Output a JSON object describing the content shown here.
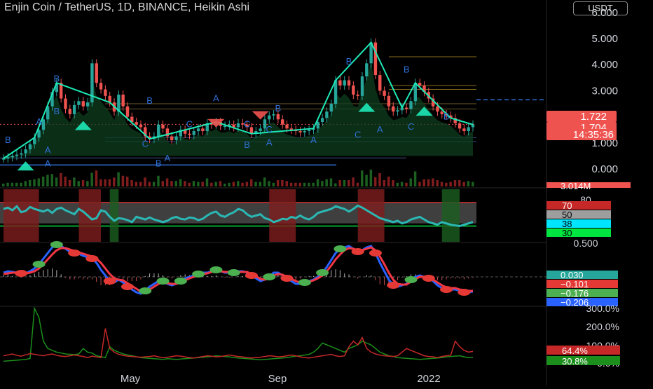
{
  "header": {
    "title": "Enjin Coin / TetherUS, 1D, BINANCE, Heikin Ashi",
    "currency_button": "USDT"
  },
  "colors": {
    "background": "#000000",
    "up": "#26a69a",
    "down": "#ef5350",
    "zigzag": "#1de9b6",
    "rsi_line": "#2bb7b3",
    "macd_fast": "#2962ff",
    "macd_slow": "#f23645",
    "dot_green": "#4caf50",
    "dot_red": "#e53935",
    "label_blue": "#2f6fd6"
  },
  "x_axis": {
    "labels": [
      "May",
      "Sep",
      "2022"
    ]
  },
  "chart_data": [
    {
      "type": "candlestick",
      "pane": "price",
      "ylim": [
        0,
        6
      ],
      "y_ticks": [
        "6.000",
        "5.000",
        "4.000",
        "3.000",
        "1.000",
        "0.000"
      ],
      "series": [
        {
          "name": "ENJUSDT",
          "values": [
            0.4,
            0.45,
            0.5,
            0.55,
            0.6,
            0.75,
            0.95,
            1.2,
            1.5,
            1.9,
            2.4,
            2.95,
            3.3,
            2.7,
            2.3,
            2.1,
            2.45,
            2.6,
            2.4,
            2.55,
            4.05,
            3.3,
            3.05,
            2.8,
            2.55,
            2.2,
            2.85,
            2.4,
            2.0,
            1.8,
            1.7,
            1.6,
            1.25,
            1.15,
            1.25,
            1.7,
            1.55,
            1.25,
            1.1,
            1.25,
            1.5,
            1.35,
            1.3,
            1.45,
            1.55,
            1.45,
            1.75,
            1.7,
            1.8,
            1.65,
            1.65,
            1.7,
            1.6,
            1.75,
            1.7,
            1.6,
            1.35,
            1.45,
            1.55,
            1.9,
            2.05,
            2.1,
            1.9,
            1.7,
            1.55,
            1.5,
            1.45,
            1.4,
            1.45,
            1.5,
            1.55,
            1.8,
            1.95,
            2.2,
            2.5,
            3.4,
            3.2,
            3.4,
            3.2,
            2.85,
            2.8,
            3.55,
            4.05,
            4.85,
            3.6,
            3.0,
            2.8,
            2.4,
            2.2,
            2.25,
            2.35,
            2.3,
            2.6,
            3.3,
            3.2,
            2.95,
            2.7,
            2.4,
            2.2,
            2.1,
            2.05,
            1.95,
            1.75,
            1.55,
            1.45,
            1.6,
            1.7
          ]
        }
      ],
      "price_labels": [
        {
          "text": "1.722",
          "color": "#ef5350"
        },
        {
          "text": "1.704",
          "color": "#ef5350"
        },
        {
          "text": "14:35:36",
          "color": "#ef5350"
        }
      ],
      "volume_label": {
        "text": "3.014M",
        "color": "#ef5350"
      },
      "pattern_labels": [
        "B",
        "B",
        "A",
        "B",
        "C",
        "A",
        "B",
        "A",
        "C",
        "B",
        "A",
        "B",
        "C",
        "A",
        "B",
        "C",
        "A",
        "B",
        "C",
        "A",
        "B",
        "C",
        "A",
        "B"
      ]
    },
    {
      "type": "line",
      "pane": "rsi",
      "ylim": [
        10,
        90
      ],
      "y_ticks": [
        "80"
      ],
      "levels": [
        {
          "text": "70",
          "color": "#c62828",
          "text_color": "#ffffff"
        },
        {
          "text": "50",
          "color": "#9e9e9e",
          "text_color": "#000000"
        },
        {
          "text": "38",
          "color": "#00e5ff",
          "text_color": "#000000"
        },
        {
          "text": "30",
          "color": "#00e640",
          "text_color": "#000000"
        }
      ],
      "series": [
        {
          "name": "RSI",
          "values": [
            60,
            62,
            58,
            64,
            55,
            57,
            63,
            60,
            58,
            56,
            59,
            54,
            60,
            62,
            58,
            55,
            52,
            60,
            56,
            50,
            44,
            46,
            58,
            56,
            48,
            42,
            46,
            45,
            43,
            40,
            48,
            46,
            44,
            47,
            44,
            42,
            40,
            42,
            46,
            48,
            45,
            44,
            47,
            46,
            43,
            45,
            50,
            54,
            56,
            50,
            48,
            52,
            55,
            60,
            58,
            52,
            48,
            50,
            52,
            46,
            44,
            40,
            42,
            45,
            44,
            48,
            46,
            50,
            46,
            44,
            48,
            54,
            56,
            58,
            60,
            64,
            62,
            60,
            56,
            60,
            65,
            62,
            58,
            54,
            50,
            46,
            44,
            42,
            40,
            42,
            38,
            40,
            44,
            46,
            48,
            44,
            40,
            38,
            36,
            40,
            38,
            36,
            35,
            34,
            36,
            38,
            40
          ]
        }
      ]
    },
    {
      "type": "line",
      "pane": "macd",
      "y_ticks": [
        "0.500"
      ],
      "value_labels": [
        {
          "text": "0.030",
          "color": "#26a69a"
        },
        {
          "text": "−0.101",
          "color": "#e53935"
        },
        {
          "text": "−0.176",
          "color": "#4caf50"
        },
        {
          "text": "−0.206",
          "color": "#2962ff"
        }
      ],
      "series": [
        {
          "name": "fast",
          "values": [
            0.06,
            0.08,
            0.07,
            0.06,
            0.05,
            0.05,
            0.08,
            0.12,
            0.18,
            0.26,
            0.34,
            0.42,
            0.46,
            0.44,
            0.4,
            0.36,
            0.34,
            0.33,
            0.3,
            0.28,
            0.26,
            0.2,
            0.1,
            0.02,
            -0.06,
            -0.08,
            -0.04,
            -0.08,
            -0.14,
            -0.18,
            -0.22,
            -0.24,
            -0.2,
            -0.14,
            -0.1,
            -0.06,
            -0.06,
            -0.1,
            -0.12,
            -0.1,
            -0.06,
            -0.02,
            0.0,
            0.02,
            0.04,
            0.06,
            0.06,
            0.08,
            0.1,
            0.08,
            0.06,
            0.06,
            0.06,
            0.08,
            0.08,
            0.06,
            0.02,
            -0.02,
            -0.06,
            -0.04,
            0.0,
            0.06,
            0.06,
            0.02,
            -0.02,
            -0.06,
            -0.1,
            -0.1,
            -0.08,
            -0.06,
            -0.04,
            0.0,
            0.06,
            0.14,
            0.24,
            0.34,
            0.4,
            0.42,
            0.44,
            0.4,
            0.36,
            0.38,
            0.42,
            0.44,
            0.34,
            0.2,
            0.08,
            -0.04,
            -0.12,
            -0.14,
            -0.12,
            -0.1,
            -0.04,
            0.0,
            0.02,
            0.0,
            -0.02,
            -0.06,
            -0.12,
            -0.16,
            -0.18,
            -0.18,
            -0.18,
            -0.2,
            -0.22,
            -0.22,
            -0.21
          ]
        },
        {
          "name": "slow",
          "values": [
            0.04,
            0.05,
            0.06,
            0.06,
            0.06,
            0.05,
            0.06,
            0.08,
            0.12,
            0.18,
            0.25,
            0.32,
            0.38,
            0.41,
            0.41,
            0.39,
            0.37,
            0.35,
            0.33,
            0.31,
            0.29,
            0.26,
            0.2,
            0.12,
            0.04,
            -0.02,
            -0.04,
            -0.05,
            -0.09,
            -0.13,
            -0.17,
            -0.21,
            -0.21,
            -0.18,
            -0.14,
            -0.1,
            -0.08,
            -0.09,
            -0.1,
            -0.1,
            -0.08,
            -0.05,
            -0.02,
            0.0,
            0.02,
            0.04,
            0.05,
            0.07,
            0.08,
            0.08,
            0.07,
            0.07,
            0.06,
            0.07,
            0.07,
            0.07,
            0.04,
            0.01,
            -0.03,
            -0.04,
            -0.02,
            0.02,
            0.04,
            0.03,
            0.0,
            -0.03,
            -0.06,
            -0.08,
            -0.08,
            -0.07,
            -0.05,
            -0.02,
            0.02,
            0.08,
            0.16,
            0.25,
            0.32,
            0.38,
            0.41,
            0.4,
            0.38,
            0.38,
            0.4,
            0.42,
            0.38,
            0.29,
            0.18,
            0.06,
            -0.04,
            -0.1,
            -0.11,
            -0.11,
            -0.07,
            -0.03,
            0.0,
            0.0,
            -0.01,
            -0.04,
            -0.08,
            -0.12,
            -0.15,
            -0.16,
            -0.16,
            -0.18,
            -0.19,
            -0.2,
            -0.2
          ]
        }
      ]
    },
    {
      "type": "line",
      "pane": "volatility",
      "y_ticks": [
        "300.0%",
        "200.0%",
        "100.0%",
        "0.0%"
      ],
      "value_labels": [
        {
          "text": "64.4%",
          "color": "#c62828"
        },
        {
          "text": "30.8%",
          "color": "#1b8e1b"
        }
      ],
      "series": [
        {
          "name": "red",
          "values": [
            40,
            45,
            50,
            42,
            38,
            45,
            52,
            48,
            44,
            40,
            46,
            50,
            42,
            38,
            36,
            40,
            44,
            40,
            36,
            30,
            38,
            34,
            30,
            190,
            80,
            60,
            48,
            42,
            38,
            36,
            34,
            32,
            34,
            36,
            40,
            34,
            30,
            32,
            36,
            40,
            38,
            34,
            30,
            28,
            32,
            36,
            40,
            38,
            34,
            36,
            40,
            44,
            40,
            36,
            34,
            30,
            28,
            30,
            32,
            36,
            40,
            38,
            34,
            36,
            40,
            44,
            40,
            34,
            30,
            28,
            32,
            36,
            40,
            44,
            48,
            40,
            36,
            40,
            90,
            120,
            100,
            140,
            80,
            60,
            50,
            44,
            40,
            38,
            36,
            40,
            60,
            80,
            70,
            60,
            50,
            40,
            36,
            34,
            30,
            36,
            40,
            44,
            120,
            90,
            70,
            60,
            64
          ]
        },
        {
          "name": "green",
          "values": [
            10,
            12,
            14,
            16,
            18,
            20,
            25,
            300,
            250,
            120,
            80,
            70,
            60,
            55,
            50,
            48,
            46,
            50,
            80,
            60,
            55,
            40,
            35,
            30,
            90,
            70,
            60,
            50,
            45,
            40,
            35,
            30,
            28,
            26,
            24,
            22,
            20,
            24,
            22,
            20,
            22,
            24,
            26,
            28,
            30,
            32,
            34,
            36,
            40,
            38,
            36,
            34,
            30,
            28,
            26,
            24,
            22,
            20,
            18,
            20,
            22,
            24,
            26,
            28,
            30,
            34,
            38,
            40,
            44,
            48,
            60,
            80,
            110,
            100,
            90,
            80,
            70,
            60,
            80,
            90,
            100,
            120,
            110,
            100,
            80,
            60,
            50,
            40,
            36,
            30,
            28,
            26,
            24,
            22,
            20,
            22,
            24,
            26,
            28,
            30,
            34,
            36,
            38,
            40,
            34,
            30,
            31
          ]
        }
      ]
    }
  ]
}
